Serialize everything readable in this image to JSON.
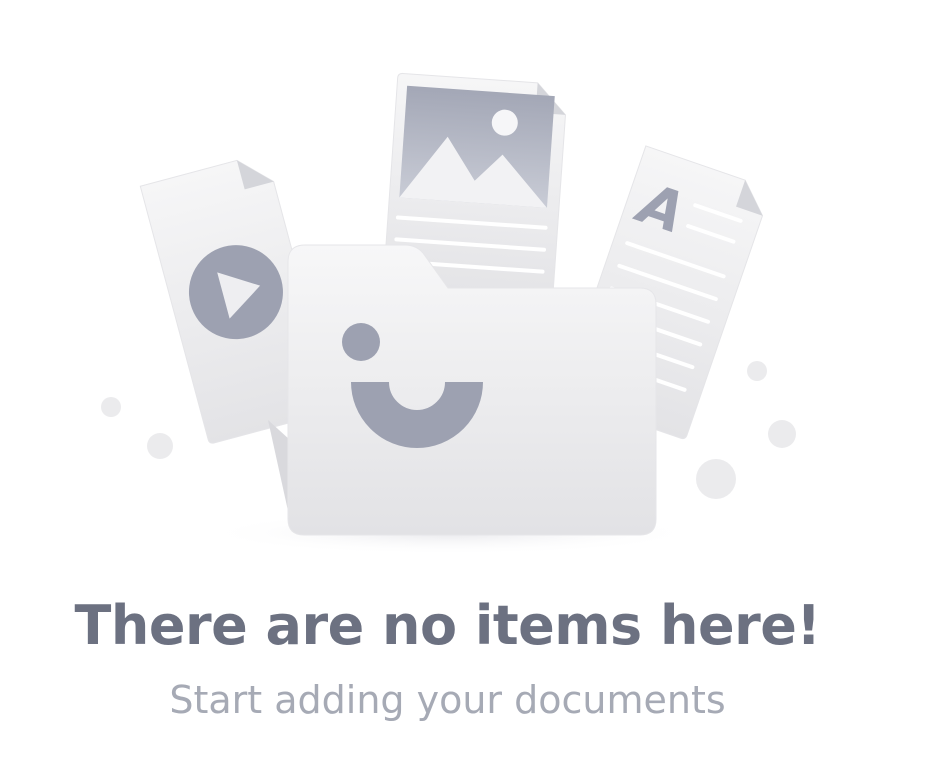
{
  "empty_state": {
    "title": "There are no items here!",
    "subtitle": "Start adding your documents"
  },
  "illustration": {
    "icons": [
      "video-document-icon",
      "image-document-icon",
      "text-document-icon",
      "smiling-folder-icon"
    ],
    "glyph_letter": "A"
  },
  "colors": {
    "title": "#6c7181",
    "subtitle": "#a6aab5",
    "illustration_gray": "#9da1b1",
    "paper": "#ececee"
  }
}
